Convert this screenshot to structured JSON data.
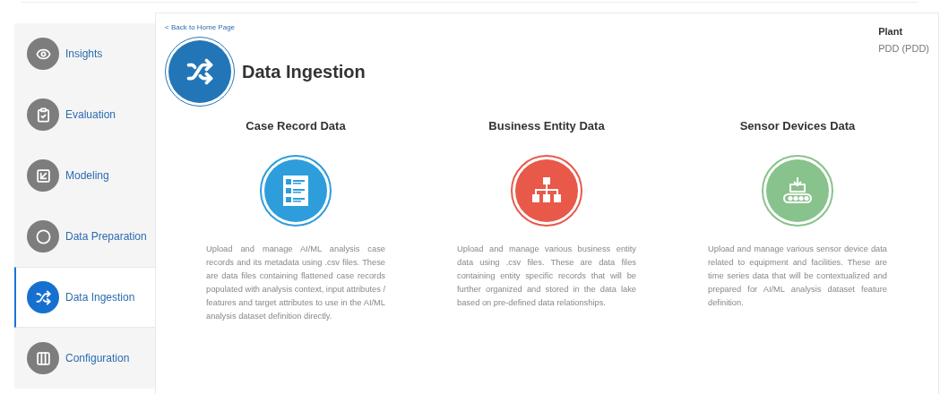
{
  "sidebar": {
    "items": [
      {
        "label": "Insights",
        "selected": false
      },
      {
        "label": "Evaluation",
        "selected": false
      },
      {
        "label": "Modeling",
        "selected": false
      },
      {
        "label": "Data Preparation",
        "selected": false
      },
      {
        "label": "Data Ingestion",
        "selected": true
      },
      {
        "label": "Configuration",
        "selected": false
      }
    ]
  },
  "header": {
    "back_link": "< Back to Home Page",
    "title": "Data Ingestion",
    "plant_label": "Plant",
    "plant_value": "PDD (PDD)"
  },
  "cards": [
    {
      "title": "Case Record Data",
      "color": "#2e9ddb",
      "description": "Upload and manage AI/ML analysis case records and its metadata using .csv files. These are data files containing flattened case records populated with analysis context, input attributes / features and target attributes to use in the AI/ML analysis dataset definition directly."
    },
    {
      "title": "Business Entity Data",
      "color": "#e8594a",
      "description": "Upload and manage various business entity data using .csv files. These are data files containing entity specific records that will be further organized and stored in the data lake based on pre-defined data relationships."
    },
    {
      "title": "Sensor Devices Data",
      "color": "#88c28c",
      "description": "Upload and manage various sensor device data related to equipment and facilities. These are time series data that will be contextualized and prepared for AI/ML analysis dataset feature definition."
    }
  ]
}
